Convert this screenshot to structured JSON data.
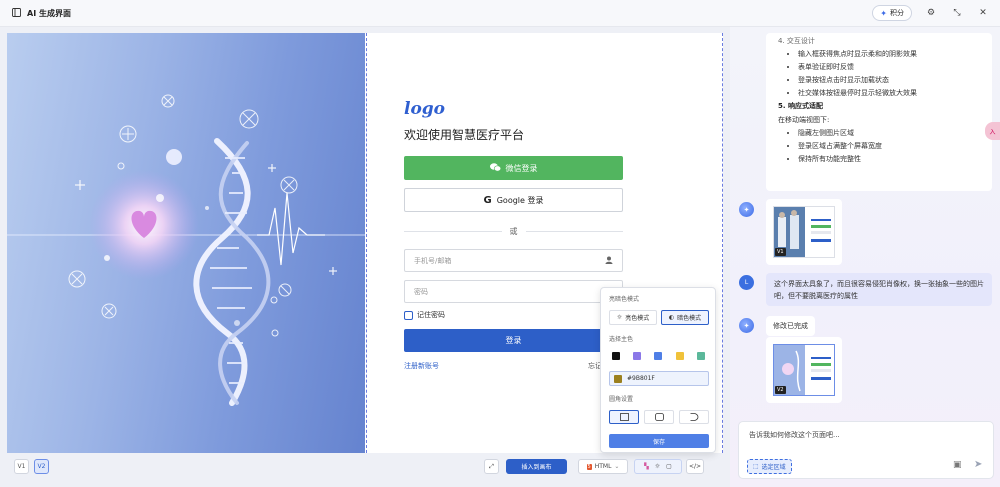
{
  "app": {
    "title": "AI 生成界面",
    "points_label": "积分"
  },
  "login": {
    "logo": "logo",
    "welcome": "欢迎使用智慧医疗平台",
    "wechat_btn": "微信登录",
    "google_btn": "Google 登录",
    "or": "或",
    "phone_placeholder": "手机号/邮箱",
    "password_placeholder": "密码",
    "remember": "记住密码",
    "login_btn": "登录",
    "register": "注册新账号",
    "forgot": "忘记"
  },
  "theme_panel": {
    "mode_label": "亮暗色模式",
    "light": "亮色模式",
    "dark": "暗色模式",
    "color_label": "选择主色",
    "swatches": [
      "#111111",
      "#8b78e8",
      "#4f7fe6",
      "#f0c23a",
      "#5bb89a"
    ],
    "hex": "#9B801F",
    "hex_color": "#9B801F",
    "radius_label": "圆角设置",
    "save": "保存"
  },
  "toolbar": {
    "v1": "V1",
    "v2": "V2",
    "insert": "插入到画布",
    "format": "HTML",
    "code_icon": "</>"
  },
  "chat": {
    "section4_title": "4. 交互设计",
    "section4_items": [
      "输入框获得焦点时显示柔和的阴影效果",
      "表单验证即时反馈",
      "登录按钮点击时显示加载状态",
      "社交媒体按钮悬停时显示轻微放大效果"
    ],
    "section5_title": "5. 响应式适配",
    "section5_intro": "在移动端视图下:",
    "section5_items": [
      "隐藏左侧图片区域",
      "登录区域占满整个屏幕宽度",
      "保持所有功能完整性"
    ],
    "thumb1_tag": "V1",
    "user_avatar": "L",
    "user_message": "这个界面太具象了，而且很容易侵犯肖像权，换一张抽象一些的图片吧，但不要脱离医疗的属性",
    "ai_reply": "修改已完成",
    "thumb2_tag": "V2",
    "input_placeholder": "告诉我如何修改这个页面吧...",
    "region_btn": "选定区域",
    "side_tab": "入"
  }
}
